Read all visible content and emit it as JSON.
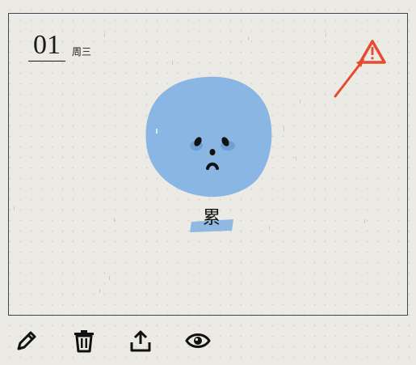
{
  "entry": {
    "day": "01",
    "weekday": "周三"
  },
  "mood": {
    "label": "累",
    "face_color": "#8ab6e3",
    "tape_color": "#8ab6e3"
  },
  "warning": {
    "icon": "warning-icon",
    "color": "#e84a2e"
  },
  "toolbar": {
    "items": [
      {
        "icon": "pencil-icon",
        "action": "edit"
      },
      {
        "icon": "trash-icon",
        "action": "delete"
      },
      {
        "icon": "share-icon",
        "action": "share"
      },
      {
        "icon": "eye-icon",
        "action": "view"
      }
    ]
  }
}
